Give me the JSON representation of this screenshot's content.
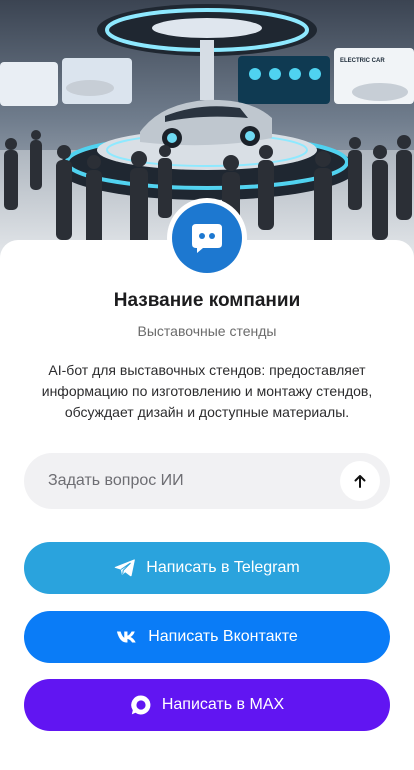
{
  "hero": {
    "image_label": "exhibition-hall-photo",
    "sign_text": "ELECTRIC CAR"
  },
  "profile": {
    "icon": "chat-bot-icon",
    "company_name": "Название компании",
    "category": "Выставочные стенды",
    "description": "AI-бот для выставочных стендов: предоставляет информацию по изготовлению и монтажу стендов, обсуждает дизайн и доступные материалы."
  },
  "ask": {
    "placeholder": "Задать вопрос ИИ",
    "send_icon": "arrow-up-icon"
  },
  "buttons": {
    "telegram": {
      "label": "Написать в Telegram",
      "icon": "telegram-icon",
      "color": "#2aa3dd"
    },
    "vk": {
      "label": "Написать Вконтакте",
      "icon": "vk-icon",
      "color": "#0a7cf7"
    },
    "max": {
      "label": "Написать в MAX",
      "icon": "max-icon",
      "color": "#6115f2"
    }
  },
  "colors": {
    "avatar": "#1d78d0",
    "input_bg": "#f1f1f3"
  }
}
